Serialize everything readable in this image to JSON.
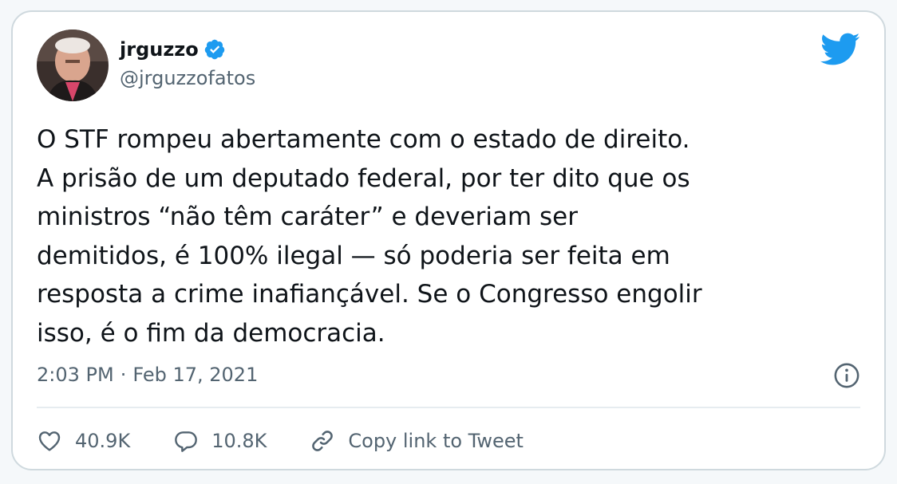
{
  "author": {
    "display_name": "jrguzzo",
    "handle": "@jrguzzofatos"
  },
  "tweet": {
    "text": "O STF rompeu abertamente com o estado de direito.\nA prisão de um deputado federal, por ter dito que os\nministros “não têm caráter” e deveriam ser\ndemitidos, é 100% ilegal — só poderia ser feita em\nresposta a crime inafiançável. Se o Congresso engolir\nisso, é o fim da democracia.",
    "time": "2:03 PM",
    "separator": "·",
    "date": "Feb 17, 2021"
  },
  "actions": {
    "likes": "40.9K",
    "replies": "10.8K",
    "copy_link_label": "Copy link to Tweet"
  },
  "colors": {
    "twitter_blue": "#1d9bf0",
    "secondary_text": "#536471",
    "border": "#cfd9de"
  }
}
